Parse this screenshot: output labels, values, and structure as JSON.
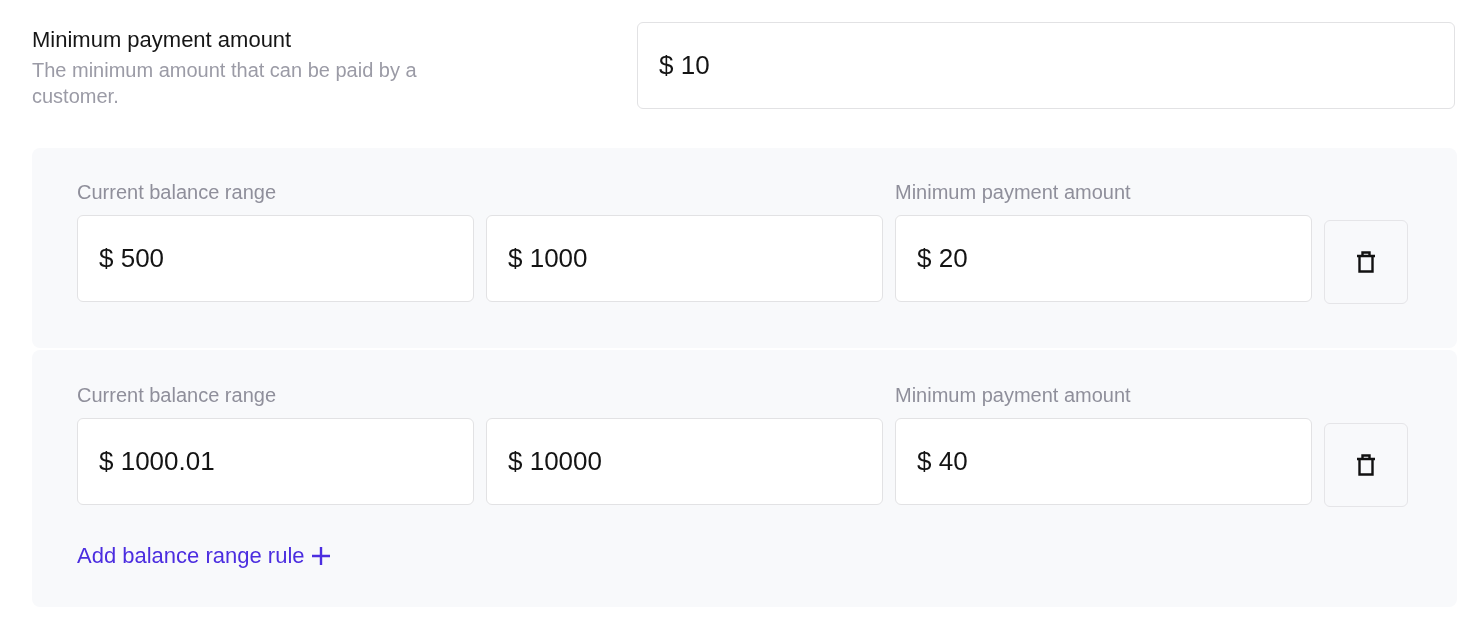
{
  "minimum_payment": {
    "label": "Minimum payment amount",
    "description": "The minimum amount that can be paid by a customer.",
    "value": "$ 10"
  },
  "rules": [
    {
      "range_label": "Current balance range",
      "from": "$ 500",
      "to": "$ 1000",
      "amount_label": "Minimum payment amount",
      "amount": "$ 20"
    },
    {
      "range_label": "Current balance range",
      "from": "$ 1000.01",
      "to": "$ 10000",
      "amount_label": "Minimum payment amount",
      "amount": "$ 40"
    }
  ],
  "add_rule_link": {
    "label": "Add balance range rule"
  }
}
